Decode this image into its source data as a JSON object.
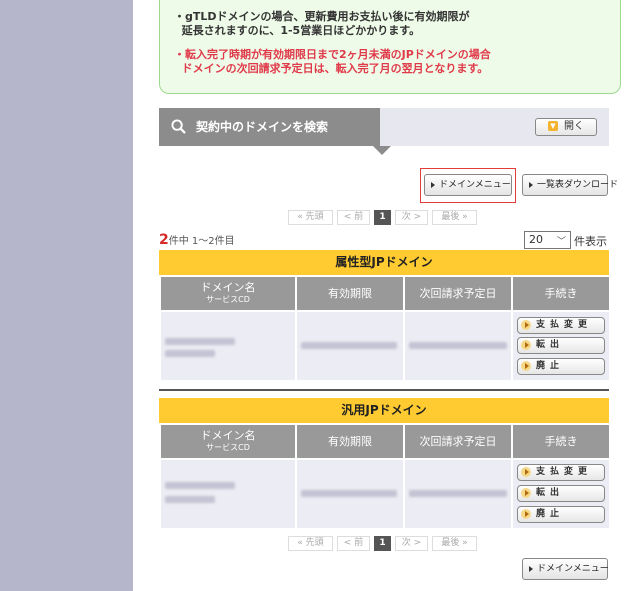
{
  "notice": {
    "line1a": "・gTLDドメインの場合、更新費用お支払い後に有効期限が",
    "line1b": "延長されますのに、1-5営業日ほどかかります。",
    "line2a": "・転入完了時期が有効期限日まで2ヶ月未満のJPドメインの場合",
    "line2b": "ドメインの次回請求予定日は、転入完了月の翌月となります。"
  },
  "search": {
    "title": "契約中のドメインを検索",
    "open_label": "開く",
    "open_icon": "chevron-down-icon"
  },
  "toolbar": {
    "domain_menu": "ドメインメニュー",
    "list_download": "一覧表ダウンロード"
  },
  "pager": {
    "first": "« 先頭",
    "prev": "< 前",
    "current": "1",
    "next": "次 >",
    "last": "最後 »"
  },
  "results": {
    "total": "2",
    "count_text": "件中 1～2件目",
    "per_page": "20",
    "per_page_label": "件表示"
  },
  "table_headers": {
    "name": "ドメイン名",
    "service": "サービスCD",
    "expiry": "有効期限",
    "next_billing": "次回請求予定日",
    "procedures": "手続き"
  },
  "sections": [
    {
      "title": "属性型JPドメイン",
      "actions": [
        "支払変更",
        "転出",
        "廃止"
      ]
    },
    {
      "title": "汎用JPドメイン",
      "actions": [
        "支払変更",
        "転出",
        "廃止"
      ]
    }
  ],
  "colors": {
    "sidebar": "#b5b5cb",
    "section_header": "#ffcb30",
    "alert": "#e03a4a",
    "highlight": "#e23b3b"
  }
}
